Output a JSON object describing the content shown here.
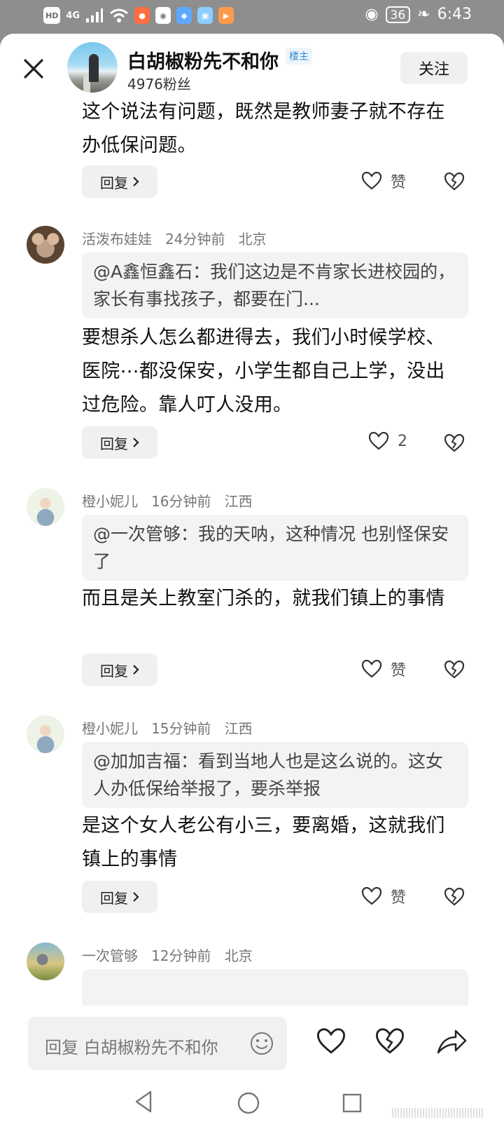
{
  "status_bar": {
    "left_items": [
      "HD",
      "4G",
      "signal-icon",
      "wifi-icon",
      "weibo-icon",
      "wechat-icon",
      "blue-app-icon",
      "book-app-icon",
      "video-app-icon"
    ],
    "battery": "36",
    "time": "6:43"
  },
  "header": {
    "author_name": "白胡椒粉先不和你",
    "author_badge": "楼主",
    "fans": "4976粉丝",
    "follow_label": "关注"
  },
  "main_post": {
    "text": "这个说法有问题，既然是教师妻子就不存在办低保问题。",
    "reply_label": "回复",
    "like_label": "赞"
  },
  "comments": [
    {
      "user": "活泼布娃娃",
      "time": "24分钟前",
      "location": "北京",
      "quote": "@A鑫恒鑫石：我们这边是不肯家长进校园的，家长有事找孩子，都要在门...",
      "text": "要想杀人怎么都进得去，我们小时候学校、医院⋯都没保安，小学生都自己上学，没出过危险。靠人叮人没用。",
      "reply_label": "回复",
      "like_label": "2"
    },
    {
      "user": "橙小妮儿",
      "time": "16分钟前",
      "location": "江西",
      "quote": "@一次管够：我的天呐，这种情况 也别怪保安了",
      "text": "而且是关上教室门杀的，就我们镇上的事情",
      "reply_label": "回复",
      "like_label": "赞"
    },
    {
      "user": "橙小妮儿",
      "time": "15分钟前",
      "location": "江西",
      "quote": "@加加吉福：看到当地人也是这么说的。这女人办低保给举报了，要杀举报",
      "text": "是这个女人老公有小三，要离婚，这就我们镇上的事情",
      "reply_label": "回复",
      "like_label": "赞"
    },
    {
      "user": "一次管够",
      "time": "12分钟前",
      "location": "北京"
    }
  ],
  "bottom_bar": {
    "input_placeholder": "回复 白胡椒粉先不和你"
  },
  "icons": [
    "close-icon",
    "heart-icon",
    "broken-heart-icon",
    "chevron-right-icon",
    "emoji-icon",
    "share-icon",
    "nav-back-icon",
    "nav-home-icon",
    "nav-recent-icon"
  ]
}
